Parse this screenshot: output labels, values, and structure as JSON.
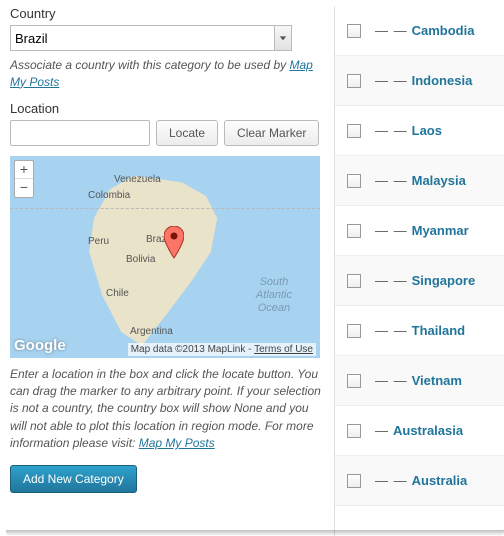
{
  "left": {
    "country_label": "Country",
    "country_value": "Brazil",
    "country_help_pre": "Associate a country with this category to be used by ",
    "country_help_link": "Map My Posts",
    "location_label": "Location",
    "locate_btn": "Locate",
    "clear_btn": "Clear Marker",
    "map": {
      "zoom_in": "+",
      "zoom_out": "−",
      "labels": {
        "venezuela": "Venezuela",
        "colombia": "Colombia",
        "brazil": "Brazil",
        "peru": "Peru",
        "bolivia": "Bolivia",
        "chile": "Chile",
        "argentina": "Argentina"
      },
      "ocean1": "South",
      "ocean2": "Atlantic",
      "ocean3": "Ocean",
      "logo": "Google",
      "attrib_pre": "Map data ©2013 MapLink ",
      "attrib_separator": "- ",
      "attrib_link": "Terms of Use"
    },
    "below_map_pre": "Enter a location in the box and click the locate button. You can drag the marker to any arbitrary point. If your selection is not a country, the country box will show None and you will not able to plot this location in region mode. For more information please visit: ",
    "below_map_link": "Map My Posts",
    "add_btn": "Add New Category"
  },
  "categories": [
    {
      "indent": "— —",
      "name": "Cambodia"
    },
    {
      "indent": "— —",
      "name": "Indonesia"
    },
    {
      "indent": "— —",
      "name": "Laos"
    },
    {
      "indent": "— —",
      "name": "Malaysia"
    },
    {
      "indent": "— —",
      "name": "Myanmar"
    },
    {
      "indent": "— —",
      "name": "Singapore"
    },
    {
      "indent": "— —",
      "name": "Thailand"
    },
    {
      "indent": "— —",
      "name": "Vietnam"
    },
    {
      "indent": "—",
      "name": "Australasia"
    },
    {
      "indent": "— —",
      "name": "Australia"
    }
  ]
}
